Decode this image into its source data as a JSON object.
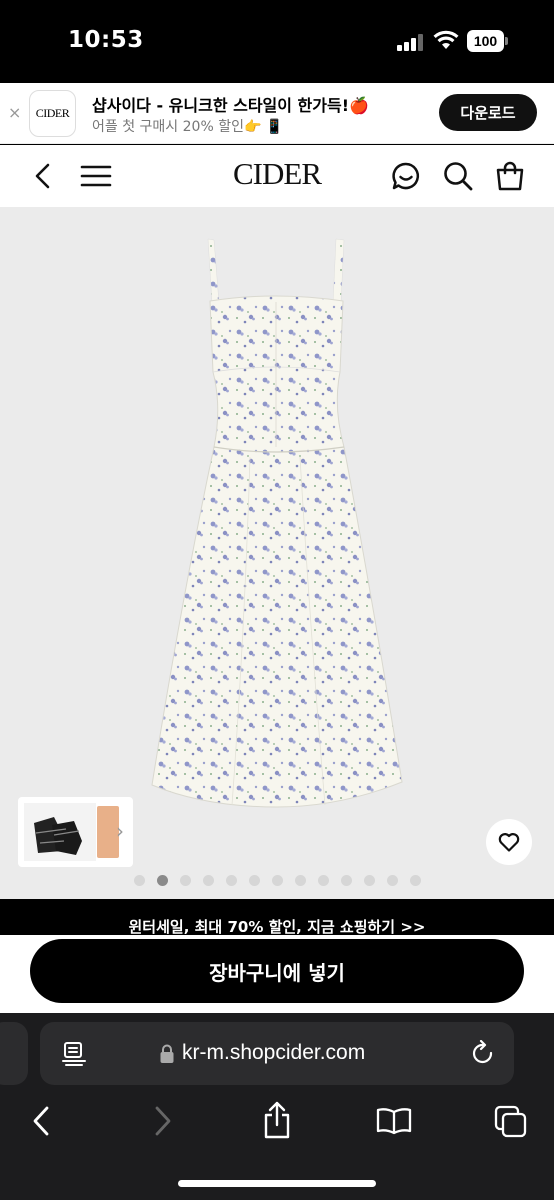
{
  "status": {
    "time": "10:53",
    "battery": "100"
  },
  "banner": {
    "close": "×",
    "logo": "CIDER",
    "title": "샵사이다 - 유니크한 스타일이 한가득!🍎",
    "subtitle": "어플 첫 구매시 20% 할인👉 📱",
    "download_label": "다운로드"
  },
  "header": {
    "logo": "CIDER"
  },
  "gallery": {
    "total_images": 13,
    "active_index": 1,
    "thumb_chevron": "›"
  },
  "promo": {
    "text": "윈터세일, 최대 70% 할인, 지금 쇼핑하기 >>"
  },
  "cart": {
    "label": "장바구니에 넣기"
  },
  "browser": {
    "url": "kr-m.shopcider.com"
  },
  "icons": {
    "back": "chevron-left-icon",
    "menu": "hamburger-icon",
    "chat": "chat-bubble-icon",
    "search": "search-icon",
    "bag": "shopping-bag-icon",
    "wish": "heart-icon"
  }
}
